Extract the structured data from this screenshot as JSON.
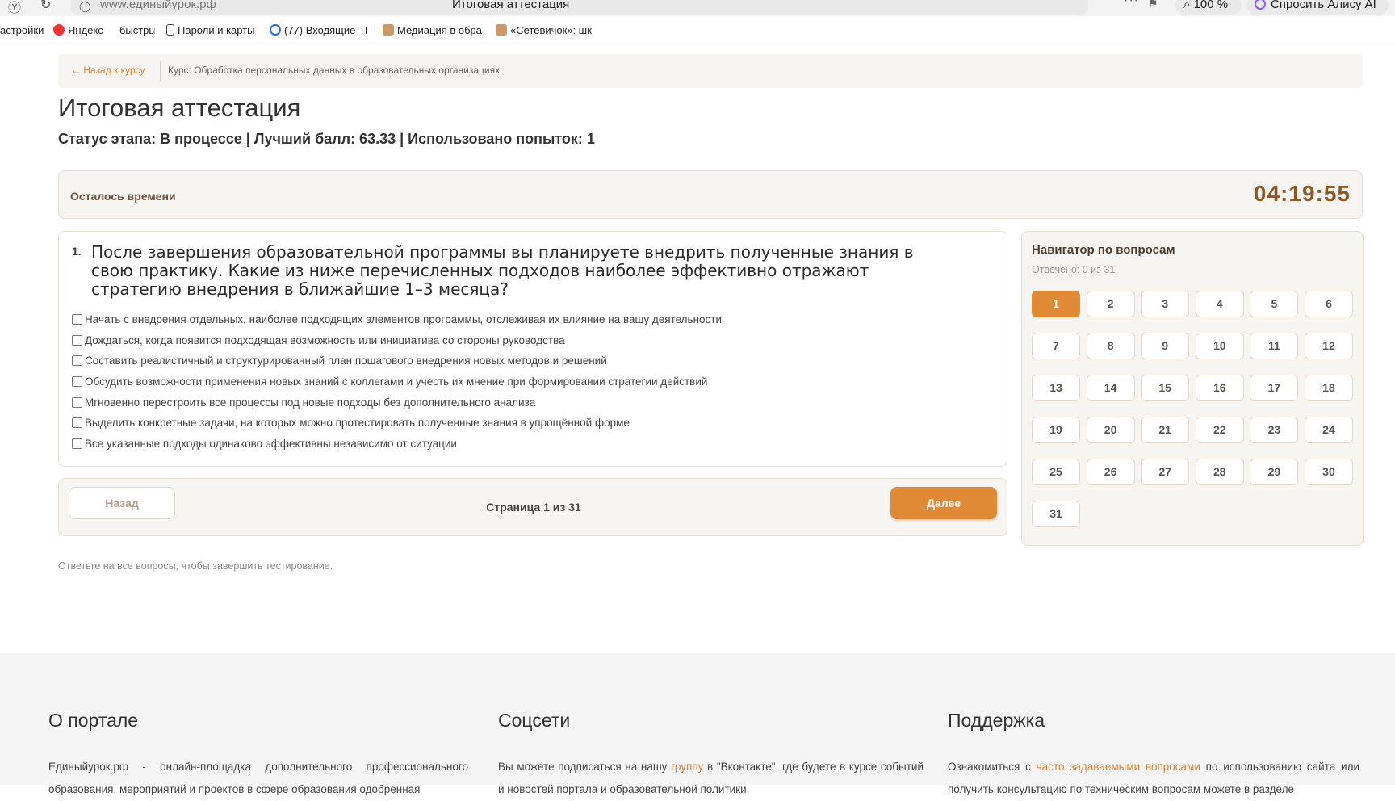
{
  "browser": {
    "url": "www.единыйурок.рф",
    "tab_title": "Итоговая аттестация",
    "zoom": "100 %",
    "alice": "Спросить Алису AI",
    "bookmarks": [
      "астройки",
      "Яндекс — быстры",
      "Пароли и карты",
      "(77) Входящие - Г",
      "Медиация в обра",
      "«Сетевичок»: шк"
    ]
  },
  "breadcrumb": {
    "back": "← Назад к курсу",
    "course": "Курс: Обработка персональных данных в образовательных организациях"
  },
  "page_title": "Итоговая аттестация",
  "status_line": "Статус этапа: В процессе | Лучший балл: 63.33 | Использовано попыток: 1",
  "timer": {
    "label": "Осталось времени",
    "value": "04:19:55"
  },
  "question": {
    "number": "1.",
    "text": "После завершения образовательной программы вы планируете внедрить полученные знания в свою практику. Какие из ниже перечисленных подходов наиболее эффективно отражают стратегию внедрения в ближайшие 1–3 месяца?",
    "options": [
      "Начать с внедрения отдельных, наиболее подходящих элементов программы, отслеживая их влияние на вашу деятельности",
      "Дождаться, когда появится подходящая возможность или инициатива со стороны руководства",
      "Составить реалистичный и структурированный план пошагового внедрения новых методов и решений",
      "Обсудить возможности применения новых знаний с коллегами и учесть их мнение при формировании стратегии действий",
      "Мгновенно перестроить все процессы под новые подходы без дополнительного анализа",
      "Выделить конкретные задачи, на которых можно протестировать полученные знания в упрощённой форме",
      "Все указанные подходы одинаково эффективны независимо от ситуации"
    ]
  },
  "pager": {
    "back": "Назад",
    "info": "Страница 1 из 31",
    "next": "Далее"
  },
  "note": "Ответьте на все вопросы, чтобы завершить тестирование.",
  "navigator": {
    "title": "Навигатор по вопросам",
    "answered": "Отвечено: 0 из 31",
    "current": "1",
    "items": [
      "1",
      "2",
      "3",
      "4",
      "5",
      "6",
      "7",
      "8",
      "9",
      "10",
      "11",
      "12",
      "13",
      "14",
      "15",
      "16",
      "17",
      "18",
      "19",
      "20",
      "21",
      "22",
      "23",
      "24",
      "25",
      "26",
      "27",
      "28",
      "29",
      "30",
      "31"
    ]
  },
  "footer": {
    "about": {
      "title": "О портале",
      "text": "Единыйурок.рф - онлайн-площадка дополнительного профессионального образования, мероприятий и проектов в сфере образования одобренная"
    },
    "social": {
      "title": "Соцсети",
      "text_before": "Вы можете подписаться на нашу ",
      "link": "группу",
      "text_after": " в \"Вконтакте\", где будете в курсе событий и новостей портала и образовательной политики."
    },
    "support": {
      "title": "Поддержка",
      "text_before": "Ознакомиться с ",
      "link": "часто задаваемыми вопросами",
      "text_after": " по использованию сайта или получить консультацию по техническим вопросам можете в разделе"
    }
  },
  "colors": {
    "accent": "#e08a35",
    "timer": "#8b5a2b",
    "panel_bg": "#f7f5f1"
  }
}
